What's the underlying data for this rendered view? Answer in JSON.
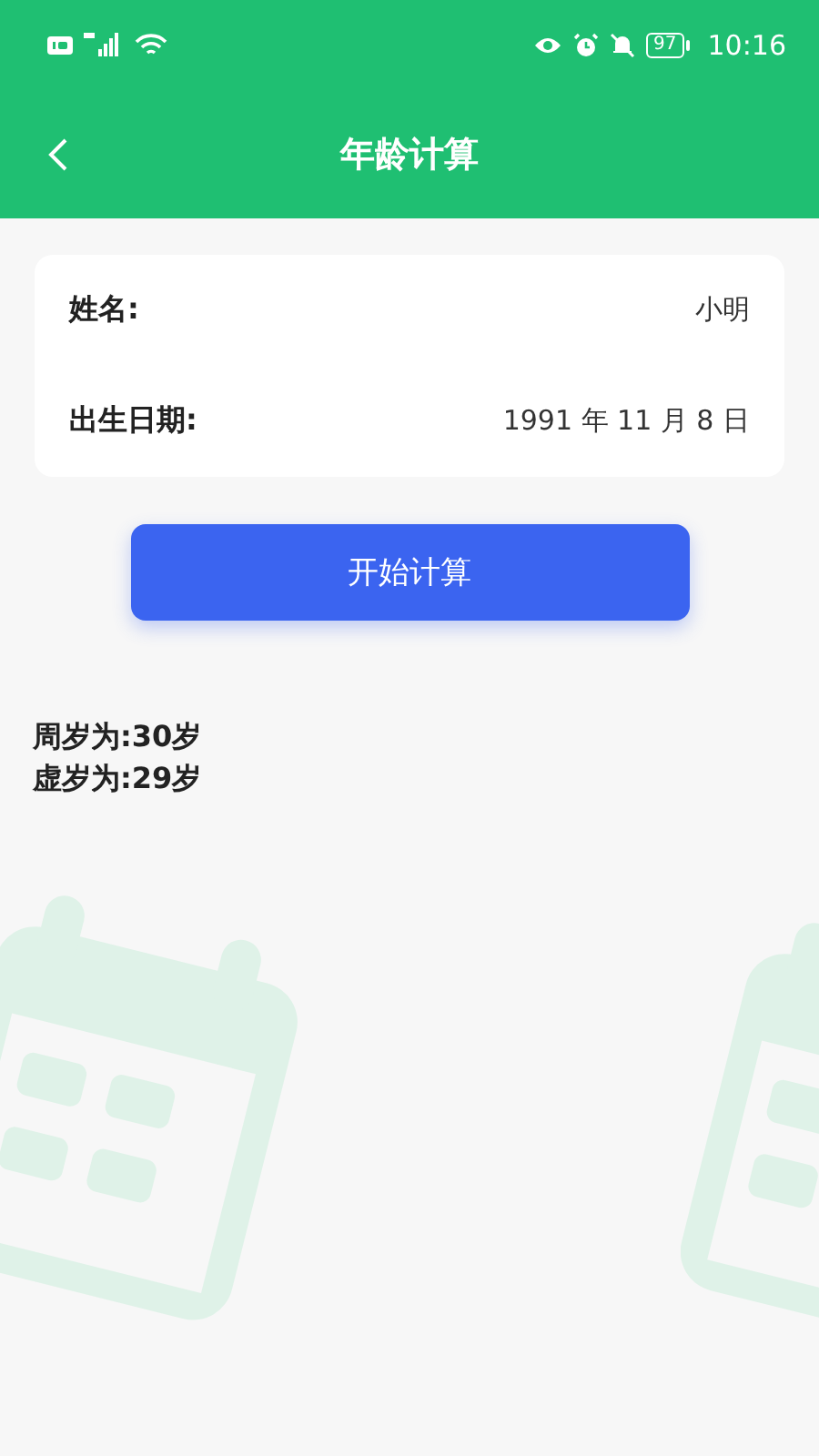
{
  "status_bar": {
    "battery": "97",
    "time": "10:16"
  },
  "header": {
    "title": "年龄计算"
  },
  "form": {
    "rows": [
      {
        "label": "姓名:",
        "value": "小明"
      },
      {
        "label": "出生日期:",
        "value": "1991 年 11 月 8 日"
      }
    ]
  },
  "calculate_button": "开始计算",
  "results": [
    "周岁为:30岁",
    "虚岁为:29岁"
  ]
}
